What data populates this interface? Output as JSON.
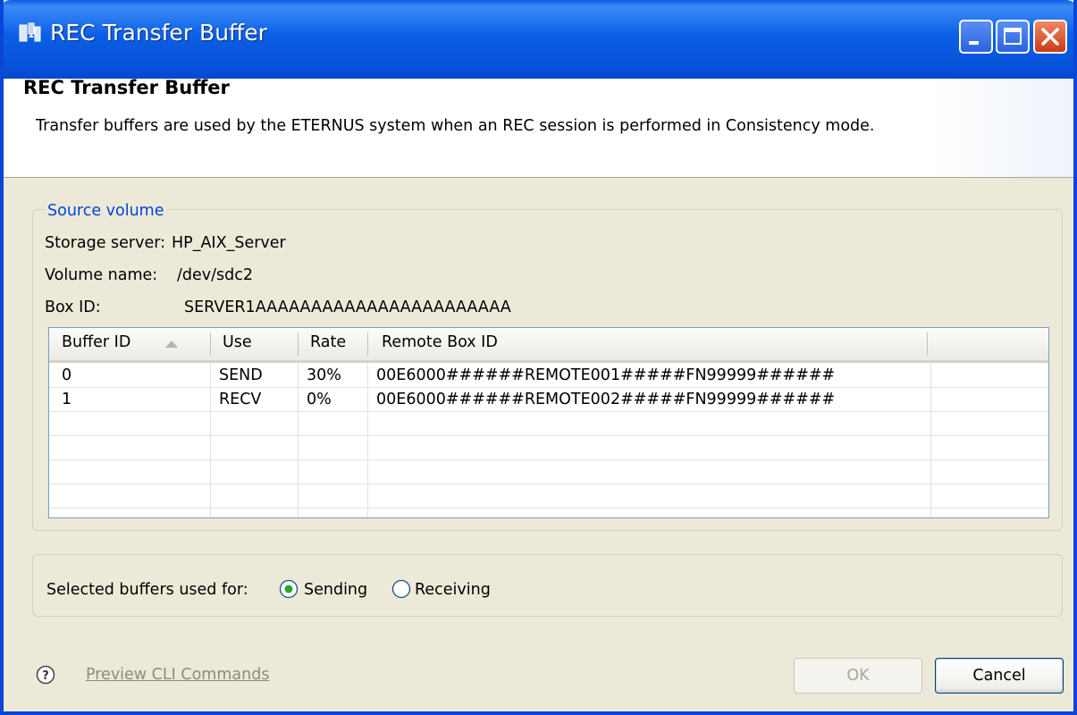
{
  "window": {
    "title": "REC Transfer Buffer"
  },
  "header": {
    "title": "REC Transfer Buffer",
    "description": "Transfer buffers are used by the ETERNUS system when an REC session is performed in Consistency mode."
  },
  "source_volume": {
    "group_label": "Source volume",
    "storage_server_label": "Storage server:",
    "storage_server_value": "HP_AIX_Server",
    "volume_name_label": "Volume name:",
    "volume_name_value": "/dev/sdc2",
    "box_id_label": "Box ID:",
    "box_id_value": "SERVER1AAAAAAAAAAAAAAAAAAAAAAA"
  },
  "table": {
    "columns": [
      "Buffer ID",
      "Use",
      "Rate",
      "Remote Box ID"
    ],
    "sort_column": "Buffer ID",
    "sort_direction": "ascending",
    "rows": [
      {
        "buffer_id": "0",
        "use": "SEND",
        "rate": "30%",
        "remote_box_id": "00E6000######REMOTE001#####FN99999######"
      },
      {
        "buffer_id": "1",
        "use": "RECV",
        "rate": "0%",
        "remote_box_id": "00E6000######REMOTE002#####FN99999######"
      }
    ]
  },
  "buffers_usage": {
    "caption": "Selected buffers used for:",
    "options": [
      {
        "label": "Sending",
        "selected": true
      },
      {
        "label": "Receiving",
        "selected": false
      }
    ]
  },
  "footer": {
    "preview_cli_label": "Preview CLI Commands",
    "ok_label": "OK",
    "ok_enabled": false,
    "cancel_label": "Cancel"
  },
  "colors": {
    "titlebar": "#0a5ee8",
    "group_label": "#0046d5",
    "dialog_background": "#ece9d8",
    "disabled_text": "#a8a799"
  }
}
